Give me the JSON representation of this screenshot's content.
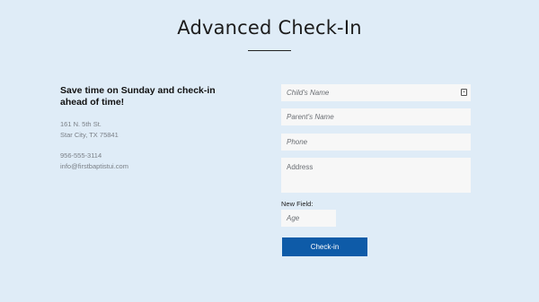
{
  "header": {
    "title": "Advanced Check-In"
  },
  "info": {
    "tagline": "Save time on Sunday and check-in ahead of time!",
    "address_line1": "161 N. 5th St.",
    "address_line2": "Star City, TX 75841",
    "phone": "956-555-3114",
    "email": "info@firstbaptistui.com"
  },
  "form": {
    "child_name_placeholder": "Child's Name",
    "parent_name_placeholder": "Parent's Name",
    "phone_placeholder": "Phone",
    "address_placeholder": "Address",
    "new_field_label": "New Field:",
    "age_placeholder": "Age",
    "submit_label": "Check-in"
  },
  "colors": {
    "background": "#dfecf7",
    "input_bg": "#f7f7f7",
    "button_bg": "#0e5ba8",
    "button_text": "#ffffff"
  }
}
